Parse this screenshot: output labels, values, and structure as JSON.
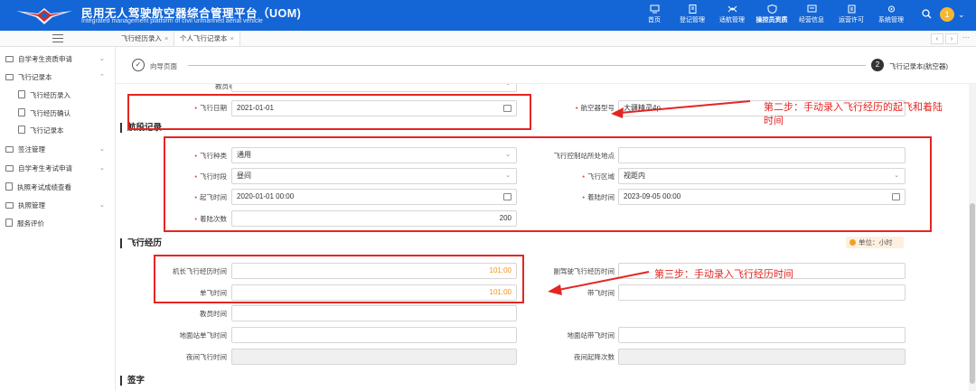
{
  "header": {
    "title": "民用无人驾驶航空器综合管理平台（UOM)",
    "subtitle": "Integrated management platform of civil unmanned aerial vehicle",
    "nav": [
      {
        "label": "首页",
        "icon": "monitor-icon"
      },
      {
        "label": "登记管理",
        "icon": "document-icon"
      },
      {
        "label": "适航管理",
        "icon": "drone-icon"
      },
      {
        "label": "操控员资质",
        "icon": "shield-icon"
      },
      {
        "label": "经营信息",
        "icon": "screen-icon"
      },
      {
        "label": "运营许可",
        "icon": "license-icon"
      },
      {
        "label": "系统管理",
        "icon": "settings-icon"
      }
    ],
    "active_nav": "操控员资质",
    "user_badge": "1",
    "brand_color": "#1466d6"
  },
  "tabs": [
    {
      "label": "飞行经历录入",
      "close": "×"
    },
    {
      "label": "个人飞行记录本",
      "close": "×"
    }
  ],
  "sidebar": {
    "items": [
      {
        "label": "自学考生资质申请",
        "chevron": "⌄"
      },
      {
        "label": "飞行记录本",
        "chevron": "⌃"
      },
      {
        "label": "飞行经历录入"
      },
      {
        "label": "飞行经历确认"
      },
      {
        "label": "飞行记录本"
      },
      {
        "label": "签注管理",
        "chevron": "⌄"
      },
      {
        "label": "自学考生考试申请",
        "chevron": "⌄"
      },
      {
        "label": "执照考试成绩查看"
      },
      {
        "label": "执照管理",
        "chevron": "⌄"
      },
      {
        "label": "服务评价"
      }
    ]
  },
  "steps": {
    "step1": {
      "num": "✓",
      "label": "向导页面"
    },
    "step2": {
      "num": "2",
      "label": "飞行记录本(航空器)"
    }
  },
  "form": {
    "cut_label": "教员等级",
    "flight_date": {
      "label": "飞行日期",
      "value": "2021-01-01"
    },
    "aircraft_model": {
      "label": "航空器型号",
      "value": "大疆精灵4p"
    }
  },
  "segment": {
    "title": "航段记录",
    "flight_type": {
      "label": "飞行种类",
      "value": "通用"
    },
    "control_station": {
      "label": "飞行控制站所处地点",
      "value": ""
    },
    "flight_period": {
      "label": "飞行时段",
      "value": "昼间"
    },
    "flight_area": {
      "label": "飞行区域",
      "value": "视距内"
    },
    "takeoff_time": {
      "label": "起飞时间",
      "value": "2020-01-01 00:00"
    },
    "landing_time": {
      "label": "着陆时间",
      "value": "2023-09-05 00:00"
    },
    "landing_count": {
      "label": "着陆次数",
      "value": "200"
    }
  },
  "experience": {
    "title": "飞行经历",
    "unit": "单位：小时",
    "captain_time": {
      "label": "机长飞行经历时间",
      "value": "101:00"
    },
    "copilot_time": {
      "label": "副驾驶飞行经历时间",
      "value": ""
    },
    "solo_time": {
      "label": "单飞时间",
      "value": "101:00"
    },
    "instruct_time": {
      "label": "带飞时间",
      "value": ""
    },
    "instructor_time": {
      "label": "教员时间",
      "value": ""
    },
    "ground_solo": {
      "label": "地面站单飞时间",
      "value": ""
    },
    "ground_instruct": {
      "label": "地面站带飞时间",
      "value": ""
    },
    "night_time": {
      "label": "夜间飞行时间",
      "value": ""
    },
    "night_landings": {
      "label": "夜间起降次数",
      "value": ""
    }
  },
  "signature": {
    "title": "签字"
  },
  "annotations": {
    "step2_text": "第二步：手动录入飞行经历的起飞和着陆时间",
    "step3_text": "第三步：手动录入飞行经历时间",
    "color": "#e52521"
  }
}
